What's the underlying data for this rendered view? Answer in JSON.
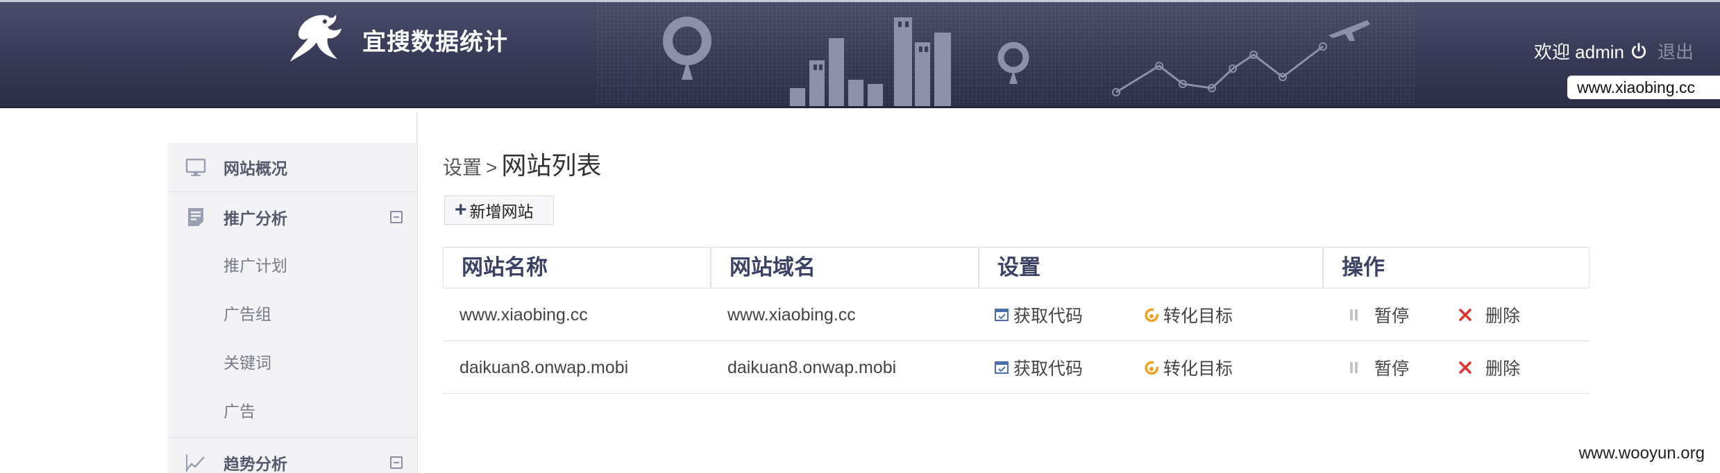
{
  "header": {
    "brand_title": "宜搜数据统计",
    "welcome_text": "欢迎 admin",
    "logout_label": "退出",
    "site_domain": "www.xiaobing.cc"
  },
  "sidebar": {
    "items": [
      {
        "label": "网站概况",
        "icon": "monitor-icon"
      },
      {
        "label": "推广分析",
        "icon": "document-icon",
        "expanded": true,
        "children": [
          "推广计划",
          "广告组",
          "关键词",
          "广告"
        ]
      },
      {
        "label": "趋势分析",
        "icon": "trend-icon",
        "expanded": true
      }
    ]
  },
  "main": {
    "breadcrumb_parent": "设置",
    "breadcrumb_sep": ">",
    "breadcrumb_current": "网站列表",
    "add_button_label": "新增网站",
    "table": {
      "columns": [
        "网站名称",
        "网站域名",
        "设置",
        "操作"
      ],
      "rows": [
        {
          "name": "www.xiaobing.cc",
          "domain": "www.xiaobing.cc",
          "get_code": "获取代码",
          "convert": "转化目标",
          "pause": "暂停",
          "delete": "删除"
        },
        {
          "name": "daikuan8.onwap.mobi",
          "domain": "daikuan8.onwap.mobi",
          "get_code": "获取代码",
          "convert": "转化目标",
          "pause": "暂停",
          "delete": "删除"
        }
      ]
    }
  },
  "watermark": "www.wooyun.org",
  "colors": {
    "header_bg": "#3a3d5a",
    "accent": "#3b4266",
    "delete_red": "#e0322c",
    "convert_orange": "#f0a020"
  }
}
